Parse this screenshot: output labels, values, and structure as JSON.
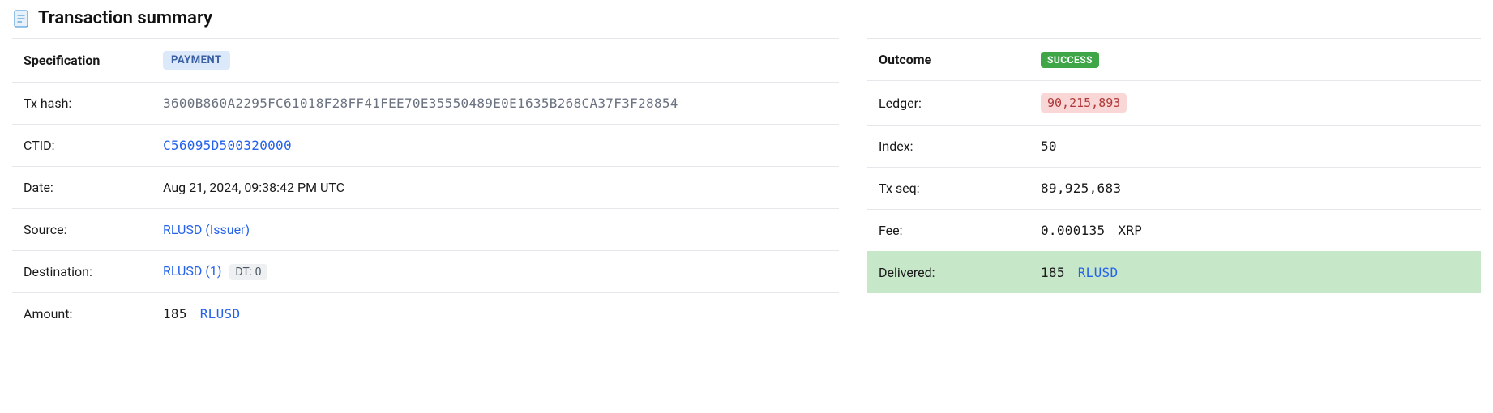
{
  "header": {
    "title": "Transaction summary"
  },
  "spec": {
    "header_label": "Specification",
    "type_badge": "PAYMENT",
    "tx_hash_label": "Tx hash:",
    "tx_hash": "3600B860A2295FC61018F28FF41FEE70E35550489E0E1635B268CA37F3F28854",
    "ctid_label": "CTID:",
    "ctid": "C56095D500320000",
    "date_label": "Date:",
    "date": "Aug 21, 2024, 09:38:42 PM UTC",
    "source_label": "Source:",
    "source": "RLUSD (Issuer)",
    "destination_label": "Destination:",
    "destination": "RLUSD (1)",
    "destination_dt": "DT: 0",
    "amount_label": "Amount:",
    "amount_value": "185",
    "amount_currency": "RLUSD"
  },
  "outcome": {
    "header_label": "Outcome",
    "status_badge": "SUCCESS",
    "ledger_label": "Ledger:",
    "ledger": "90,215,893",
    "index_label": "Index:",
    "index": "50",
    "txseq_label": "Tx seq:",
    "txseq": "89,925,683",
    "fee_label": "Fee:",
    "fee_value": "0.000135",
    "fee_currency": "XRP",
    "delivered_label": "Delivered:",
    "delivered_value": "185",
    "delivered_currency": "RLUSD"
  }
}
